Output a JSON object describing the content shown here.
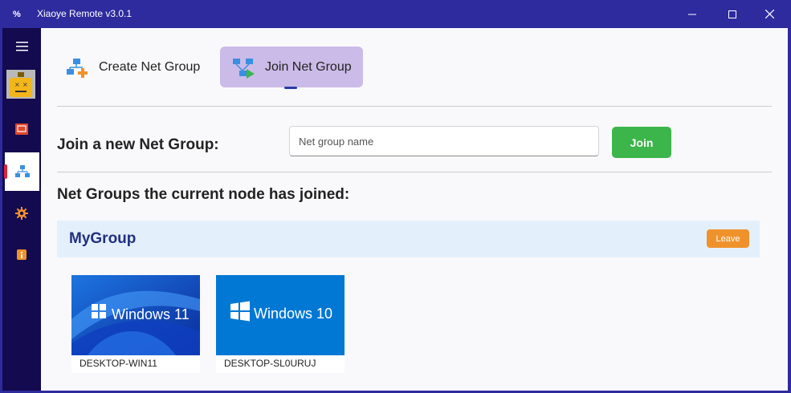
{
  "window": {
    "title": "Xiaoye Remote v3.0.1",
    "app_icon": "%"
  },
  "colors": {
    "titlebar": "#2e2b9e",
    "sidebar": "#140a4f",
    "join_button": "#3cb54a",
    "leave_button": "#f0922c",
    "selected_tab": "#cbbbe8",
    "group_header": "#e3f0fc"
  },
  "sidebar": {
    "items": [
      {
        "icon": "menu-icon"
      },
      {
        "icon": "avatar"
      },
      {
        "icon": "remote-desktop-icon"
      },
      {
        "icon": "network-icon",
        "active": true
      },
      {
        "icon": "settings-gear-icon"
      },
      {
        "icon": "info-icon"
      }
    ]
  },
  "tabs": [
    {
      "label": "Create Net Group",
      "icon": "create-network-icon",
      "selected": false
    },
    {
      "label": "Join Net Group",
      "icon": "join-network-icon",
      "selected": true
    }
  ],
  "join_section": {
    "label": "Join a new Net Group:",
    "input_placeholder": "Net group name",
    "input_value": "",
    "button_label": "Join"
  },
  "joined_section": {
    "label": "Net Groups the current node has joined:"
  },
  "groups": [
    {
      "name": "MyGroup",
      "leave_label": "Leave",
      "nodes": [
        {
          "name": "DESKTOP-WIN11",
          "os": "Windows 11"
        },
        {
          "name": "DESKTOP-SL0URUJ",
          "os": "Windows 10"
        }
      ]
    }
  ]
}
